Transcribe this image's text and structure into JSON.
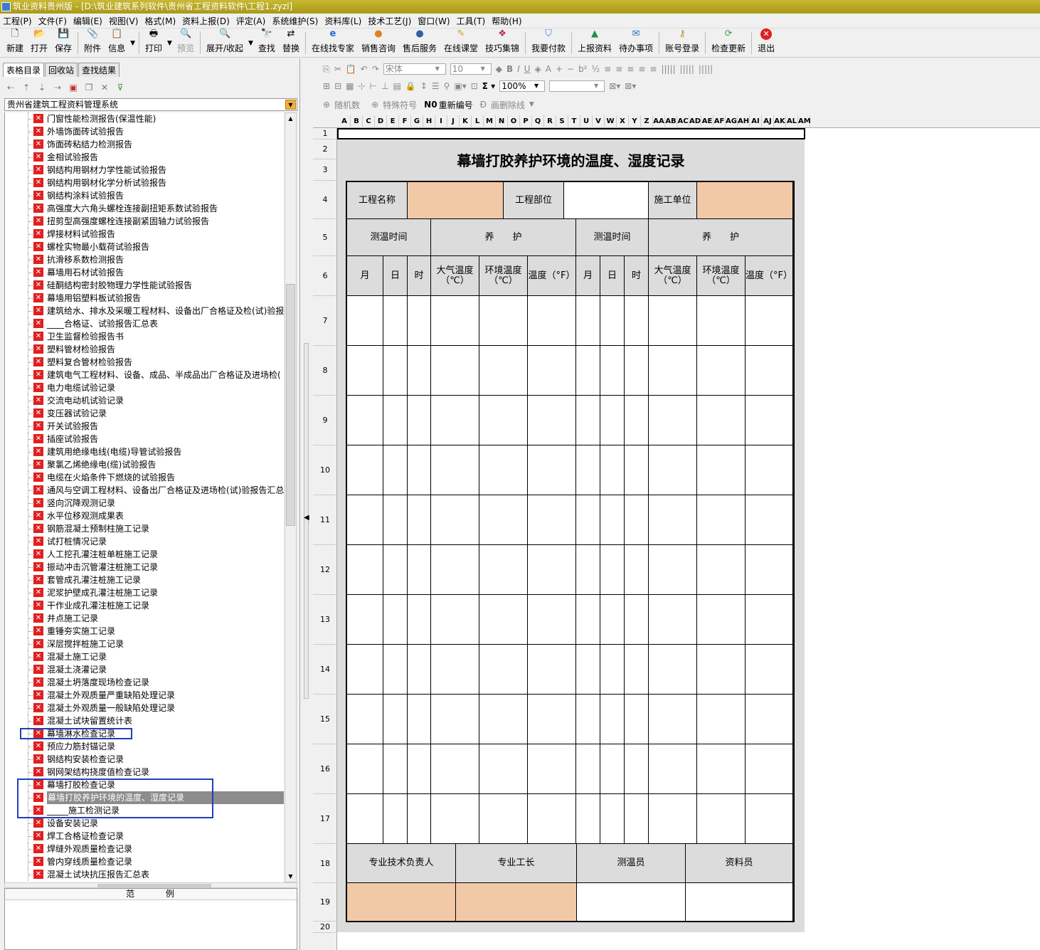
{
  "window": {
    "title": "筑业资料贵州版 - [D:\\筑业建筑系列软件\\贵州省工程资料软件\\工程1.zyzl]"
  },
  "menu": [
    "工程(P)",
    "文件(F)",
    "编辑(E)",
    "视图(V)",
    "格式(M)",
    "资料上报(D)",
    "评定(A)",
    "系统维护(S)",
    "资料库(L)",
    "技术工艺(J)",
    "窗口(W)",
    "工具(T)",
    "帮助(H)"
  ],
  "toolbar": {
    "new": "新建",
    "open": "打开",
    "save": "保存",
    "attach": "附件",
    "info": "信息",
    "print": "打印",
    "preview": "预览",
    "expand": "展开/收起",
    "find": "查找",
    "replace": "替换",
    "expert": "在线找专家",
    "sales": "销售咨询",
    "after_sales": "售后服务",
    "classroom": "在线课堂",
    "tips": "技巧集锦",
    "pay": "我要付款",
    "upload": "上报资料",
    "todo": "待办事项",
    "login": "账号登录",
    "update": "检查更新",
    "exit": "退出"
  },
  "left": {
    "tabs": [
      "表格目录",
      "回收站",
      "查找结果"
    ],
    "db": "贵州省建筑工程资料管理系统",
    "legend_left": "范",
    "legend_right": "例",
    "items": [
      "门窗性能检测报告(保温性能)",
      "外墙饰面砖试验报告",
      "饰面砖粘结力检测报告",
      "金相试验报告",
      "钢结构用钢材力学性能试验报告",
      "钢结构用钢材化学分析试验报告",
      "钢结构涂料试验报告",
      "高强度大六角头螺栓连接副扭矩系数试验报告",
      "扭剪型高强度螺栓连接副紧固轴力试验报告",
      "焊接材料试验报告",
      "螺栓实物最小载荷试验报告",
      "抗滑移系数检测报告",
      "幕墙用石材试验报告",
      "硅酮结构密封胶物理力学性能试验报告",
      "幕墙用铝塑料板试验报告",
      "建筑给水、排水及采暖工程材料、设备出厂合格证及检(试)验报",
      "____合格证、试验报告汇总表",
      "卫生监督检验报告书",
      "塑料管材检验报告",
      "塑料复合管材检验报告",
      "建筑电气工程材料、设备、成品、半成品出厂合格证及进场检(",
      "电力电缆试验记录",
      "交流电动机试验记录",
      "变压器试验记录",
      "开关试验报告",
      "插座试验报告",
      "建筑用绝缘电线(电缆)导管试验报告",
      "聚氯乙烯绝缘电(缆)试验报告",
      "电缆在火焰条件下燃烧的试验报告",
      "通风与空调工程材料、设备出厂合格证及进场检(试)验报告汇总",
      "竖向沉降观测记录",
      "水平位移观测成果表",
      "钢筋混凝土预制柱施工记录",
      "试打桩情况记录",
      "人工挖孔灌注桩单桩施工记录",
      "振动冲击沉管灌注桩施工记录",
      "套管成孔灌注桩施工记录",
      "泥浆护壁成孔灌注桩施工记录",
      "干作业成孔灌注桩施工记录",
      "井点施工记录",
      "重锤夯实施工记录",
      "深层搅拌桩施工记录",
      "混凝土施工记录",
      "混凝土浇灌记录",
      "混凝土坍落度现场检查记录",
      "混凝土外观质量严重缺陷处理记录",
      "混凝土外观质量一般缺陷处理记录",
      "混凝土试块留置统计表",
      "幕墙淋水检查记录",
      "预应力筋封锚记录",
      "钢结构安装检查记录",
      "钢网架结构挠度值检查记录",
      "幕墙打胶检查记录",
      "幕墙打胶养护环境的温度、湿度记录",
      "_____施工检测记录",
      "设备安装记录",
      "焊工合格证检查记录",
      "焊缝外观质量检查记录",
      "管内穿线质量检查记录",
      "混凝土试块抗压报告汇总表"
    ]
  },
  "format": {
    "random": "随机数",
    "special": "特殊符号",
    "renumber": "重新编号",
    "strike": "画删除线",
    "font": "宋体",
    "size": "10",
    "zoom": "100%"
  },
  "sheet": {
    "cols": [
      "A",
      "B",
      "C",
      "D",
      "E",
      "F",
      "G",
      "H",
      "I",
      "J",
      "K",
      "L",
      "M",
      "N",
      "O",
      "P",
      "Q",
      "R",
      "S",
      "T",
      "U",
      "V",
      "W",
      "X",
      "Y",
      "Z",
      "AA",
      "AB",
      "AC",
      "AD",
      "AE",
      "AF",
      "AG",
      "AH",
      "AI",
      "AJ",
      "AK",
      "AL",
      "AM"
    ],
    "rows": [
      "1",
      "2",
      "3",
      "4",
      "5",
      "6",
      "7",
      "8",
      "9",
      "10",
      "11",
      "12",
      "13",
      "14",
      "15",
      "16",
      "17",
      "18",
      "19",
      "20"
    ]
  },
  "form": {
    "title": "幕墙打胶养护环境的温度、湿度记录",
    "project_name": "工程名称",
    "project_part": "工程部位",
    "construction_unit": "施工单位",
    "measure_time": "测温时间",
    "curing": "养　　护",
    "month": "月",
    "day": "日",
    "hour": "时",
    "air_temp": "大气温度（℃）",
    "env_temp": "环境温度（℃）",
    "temp_f": "温度（°F）",
    "tech_lead": "专业技术负责人",
    "foreman": "专业工长",
    "thermometrist": "测温员",
    "archivist": "资料员"
  }
}
